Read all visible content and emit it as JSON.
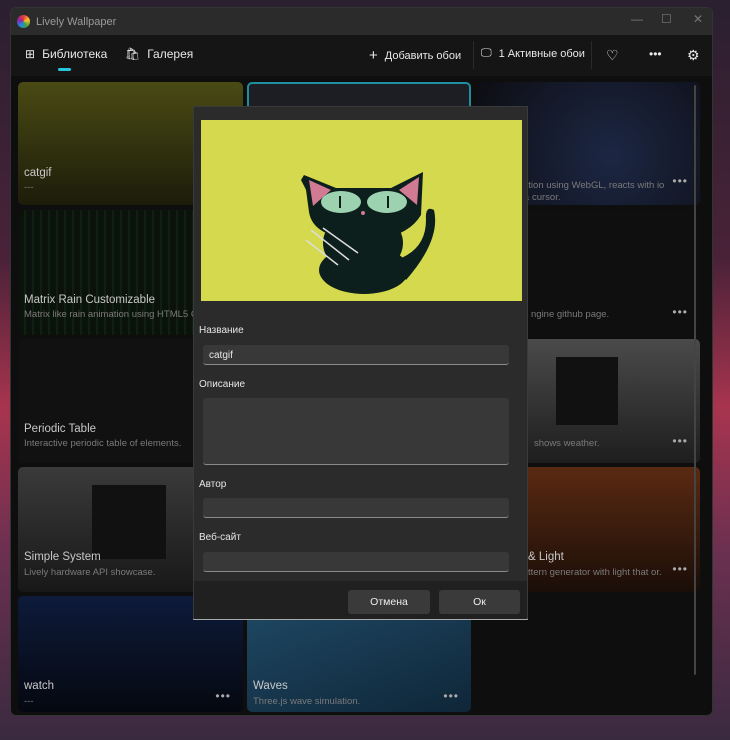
{
  "window": {
    "title": "Lively Wallpaper"
  },
  "nav": {
    "library": "Библиотека",
    "gallery": "Галерея",
    "add": "Добавить обои",
    "active": "1 Активные обои",
    "accent": "#27c6e0"
  },
  "cards": [
    {
      "title": "catgif",
      "desc": "---"
    },
    {
      "title": "Matrix Rain Customizable",
      "desc": "Matrix like rain animation using HTML5 Canvas."
    },
    {
      "title": "Periodic Table",
      "desc": "Interactive periodic table of elements."
    },
    {
      "title": "Simple System",
      "desc": "Lively hardware API showcase."
    },
    {
      "title": "watch",
      "desc": "---"
    },
    {
      "title": "Waves",
      "desc": "Three.js wave simulation."
    },
    {
      "title": "",
      "desc": "ation using WebGL, reacts with io & cursor."
    },
    {
      "title": "",
      "desc": "ngine github page."
    },
    {
      "title": "",
      "desc": "shows weather."
    },
    {
      "title": "& Light",
      "desc": "ttern generator with light that or."
    }
  ],
  "dialog": {
    "name_label": "Название",
    "name_value": "catgif",
    "desc_label": "Описание",
    "desc_value": "",
    "author_label": "Автор",
    "author_value": "",
    "site_label": "Веб-сайт",
    "site_value": "",
    "cancel": "Отмена",
    "ok": "Ок",
    "preview_color": "#d5d94d"
  }
}
